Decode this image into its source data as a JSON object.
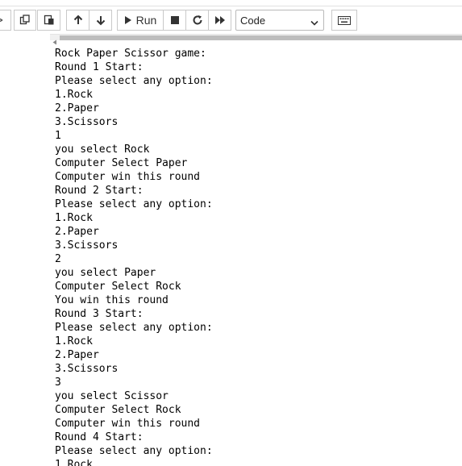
{
  "toolbar": {
    "run_label": "Run",
    "cell_type": "Code",
    "cell_type_options": [
      "Code"
    ]
  },
  "output_lines": [
    "Rock Paper Scissor game:",
    "Round 1 Start:",
    "Please select any option:",
    "1.Rock",
    "2.Paper",
    "3.Scissors",
    "1",
    "you select Rock",
    "Computer Select Paper",
    "Computer win this round",
    "Round 2 Start:",
    "Please select any option:",
    "1.Rock",
    "2.Paper",
    "3.Scissors",
    "2",
    "you select Paper",
    "Computer Select Rock",
    "You win this round",
    "Round 3 Start:",
    "Please select any option:",
    "1.Rock",
    "2.Paper",
    "3.Scissors",
    "3",
    "you select Scissor",
    "Computer Select Rock",
    "Computer win this round",
    "Round 4 Start:",
    "Please select any option:",
    "1.Rock"
  ]
}
